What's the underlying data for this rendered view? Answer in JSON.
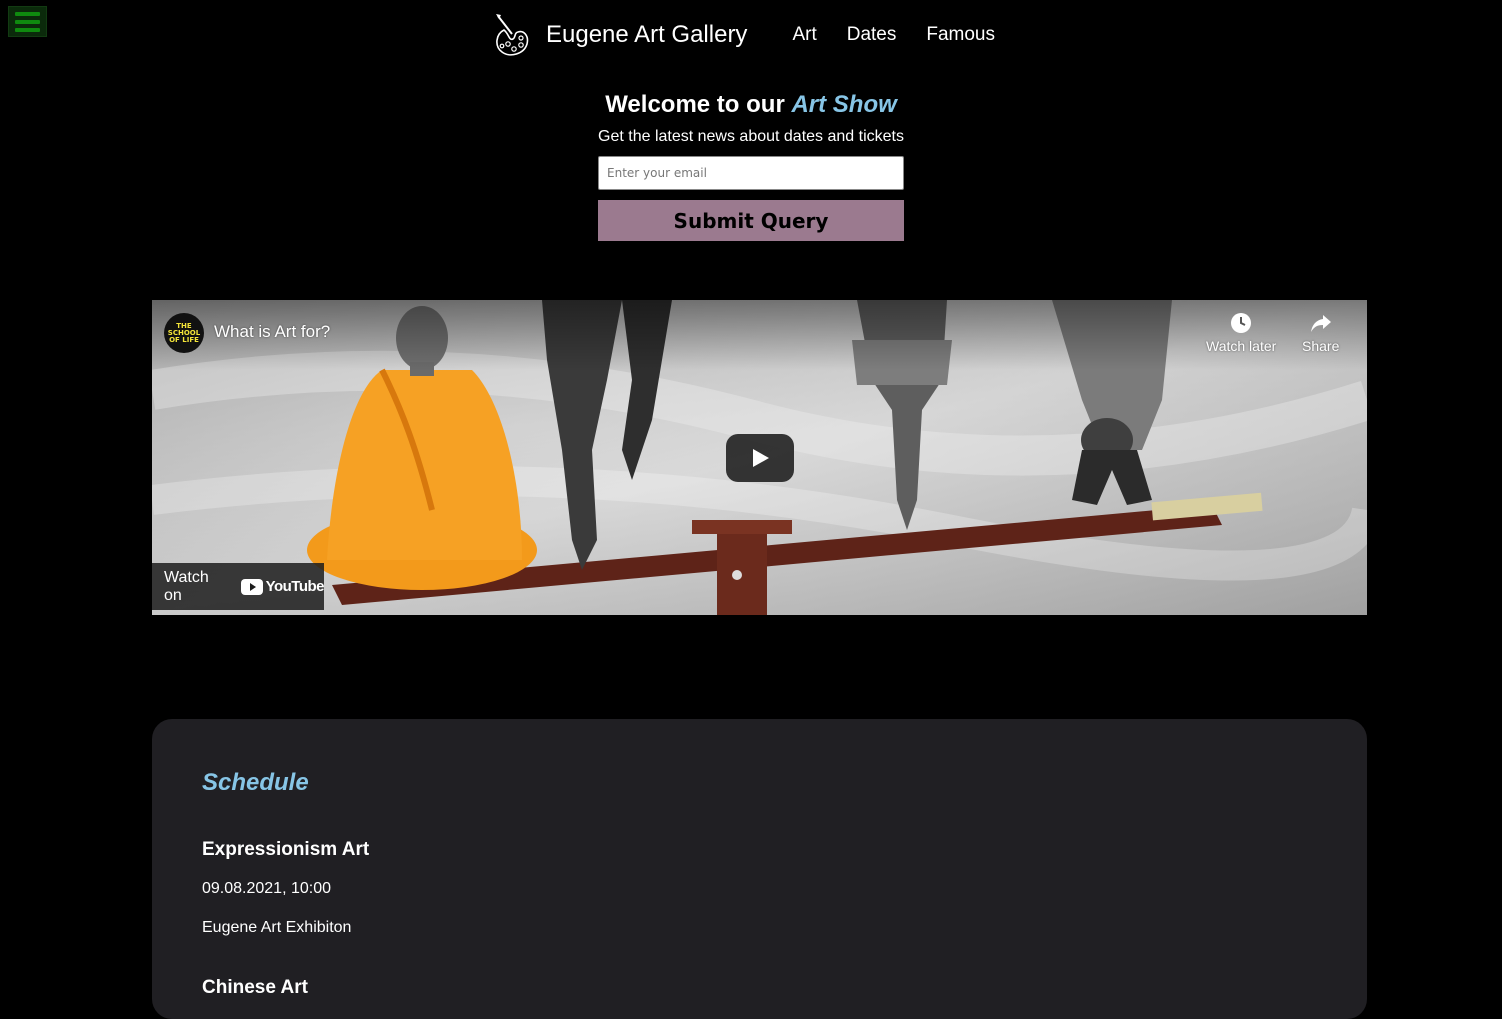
{
  "menu": {
    "icon": "hamburger-icon"
  },
  "header": {
    "logo_icon": "palette-icon",
    "brand": "Eugene Art Gallery",
    "nav": [
      "Art",
      "Dates",
      "Famous"
    ]
  },
  "newsletter": {
    "welcome_prefix": "Welcome to our ",
    "welcome_accent": "Art Show",
    "subtitle": "Get the latest news about dates and tickets",
    "email_placeholder": "Enter your email",
    "submit_label": "Submit Query"
  },
  "video": {
    "channel": "THE SCHOOL OF LIFE",
    "title": "What is Art for?",
    "watch_later": "Watch later",
    "share": "Share",
    "watch_on": "Watch on",
    "youtube": "YouTube"
  },
  "schedule": {
    "title": "Schedule",
    "events": [
      {
        "name": "Expressionism Art",
        "date": "09.08.2021, 10:00",
        "venue": "Eugene Art Exhibiton"
      },
      {
        "name": "Chinese Art"
      }
    ]
  },
  "colors": {
    "accent": "#87c5e6",
    "submit_bg": "#9b7a8f",
    "menu_green": "#0f8a0f",
    "card_bg": "#201f23"
  }
}
